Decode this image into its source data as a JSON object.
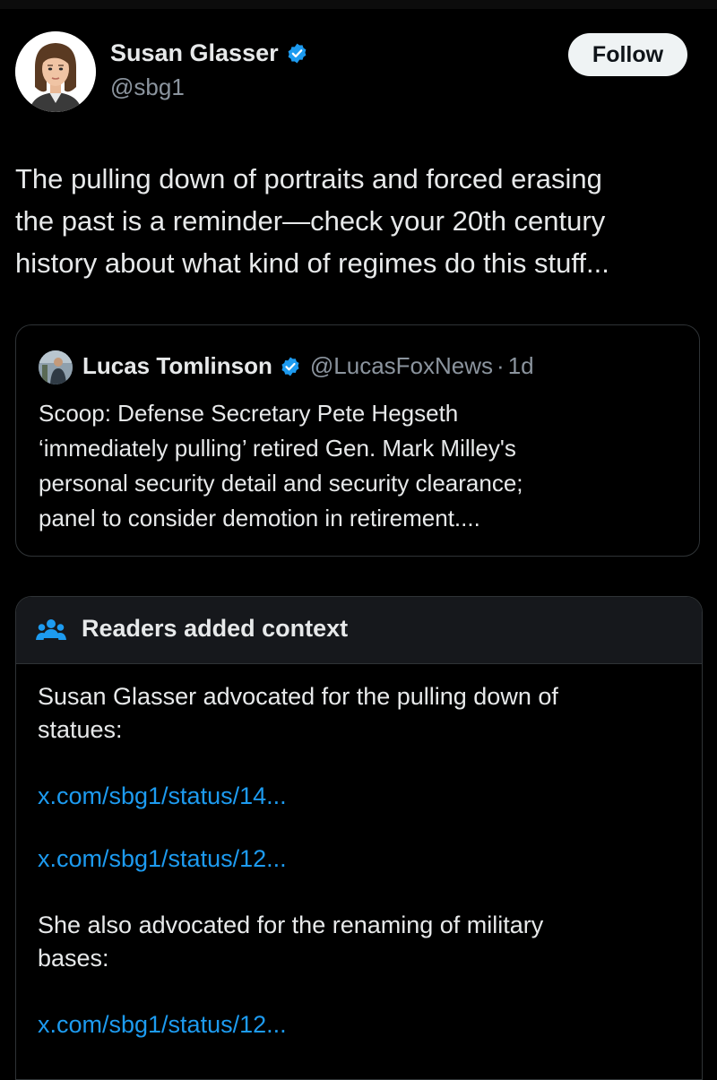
{
  "tweet": {
    "author": {
      "name": "Susan Glasser",
      "handle": "@sbg1",
      "avatar_icon": "cartoon-woman-avatar",
      "verified_icon": "verified-badge-icon"
    },
    "follow_label": "Follow",
    "text": "The pulling down of portraits and forced erasing\nthe past is a reminder—check your 20th century\nhistory about what kind of regimes do this stuff..."
  },
  "quote": {
    "author_name": "Lucas Tomlinson",
    "handle": "@LucasFoxNews",
    "separator": "·",
    "time": "1d",
    "text": "Scoop: Defense Secretary Pete Hegseth\n‘immediately pulling’ retired Gen. Mark Milley's\npersonal security detail and security clearance;\npanel to consider demotion in retirement...."
  },
  "community_note": {
    "title": "Readers added context",
    "icon": "people-icon",
    "paragraph1": "Susan Glasser advocated for the pulling down of\nstatues:",
    "links1": [
      "x.com/sbg1/status/14...",
      "x.com/sbg1/status/12..."
    ],
    "paragraph2": "She also advocated for the renaming of military\nbases:",
    "links2": [
      "x.com/sbg1/status/12..."
    ]
  },
  "colors": {
    "background": "#000000",
    "text": "#e7e9ea",
    "secondary_text": "#8b949e",
    "link": "#1d9bf0",
    "verified": "#1d9bf0",
    "border": "#2f3336"
  }
}
